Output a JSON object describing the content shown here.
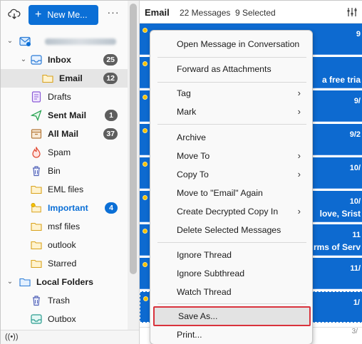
{
  "toolbar": {
    "new_message_label": "New Me...",
    "more_label": "···"
  },
  "folders": {
    "inbox": {
      "label": "Inbox",
      "count": "25"
    },
    "email": {
      "label": "Email",
      "count": "12"
    },
    "drafts": {
      "label": "Drafts"
    },
    "sent": {
      "label": "Sent Mail",
      "count": "1"
    },
    "all": {
      "label": "All Mail",
      "count": "37"
    },
    "spam": {
      "label": "Spam"
    },
    "bin": {
      "label": "Bin"
    },
    "eml": {
      "label": "EML files"
    },
    "important": {
      "label": "Important",
      "count": "4"
    },
    "msf": {
      "label": "msf files"
    },
    "outlook": {
      "label": "outlook"
    },
    "starred": {
      "label": "Starred"
    },
    "local": {
      "label": "Local Folders"
    },
    "trash": {
      "label": "Trash"
    },
    "outbox": {
      "label": "Outbox"
    }
  },
  "message_list": {
    "folder_name": "Email",
    "message_count": "22 Messages",
    "selected_count": "9 Selected",
    "rows": [
      {
        "date": "9",
        "snippet": ""
      },
      {
        "date": "",
        "snippet": "a free tria"
      },
      {
        "date": "9/",
        "snippet": ""
      },
      {
        "date": "9/2",
        "snippet": ""
      },
      {
        "date": "10/",
        "snippet": ""
      },
      {
        "date": "10/",
        "snippet": "love, Srist"
      },
      {
        "date": "11",
        "snippet": "rms of Serv"
      },
      {
        "date": "11/",
        "snippet": ""
      },
      {
        "date": "1/",
        "snippet": ""
      }
    ],
    "bottom_date": "3/"
  },
  "context_menu": {
    "open_conversation": "Open Message in Conversation",
    "forward_attachments": "Forward as Attachments",
    "tag": "Tag",
    "mark": "Mark",
    "archive": "Archive",
    "move_to": "Move To",
    "copy_to": "Copy To",
    "move_again": "Move to \"Email\" Again",
    "decrypted_copy": "Create Decrypted Copy In",
    "delete_selected": "Delete Selected Messages",
    "ignore_thread": "Ignore Thread",
    "ignore_subthread": "Ignore Subthread",
    "watch_thread": "Watch Thread",
    "save_as": "Save As...",
    "print": "Print..."
  },
  "colors": {
    "accent": "#0b6fd6",
    "selection": "#0d6ad0",
    "highlight_border": "#d9333c",
    "badge_gray": "#5e5e5e"
  }
}
